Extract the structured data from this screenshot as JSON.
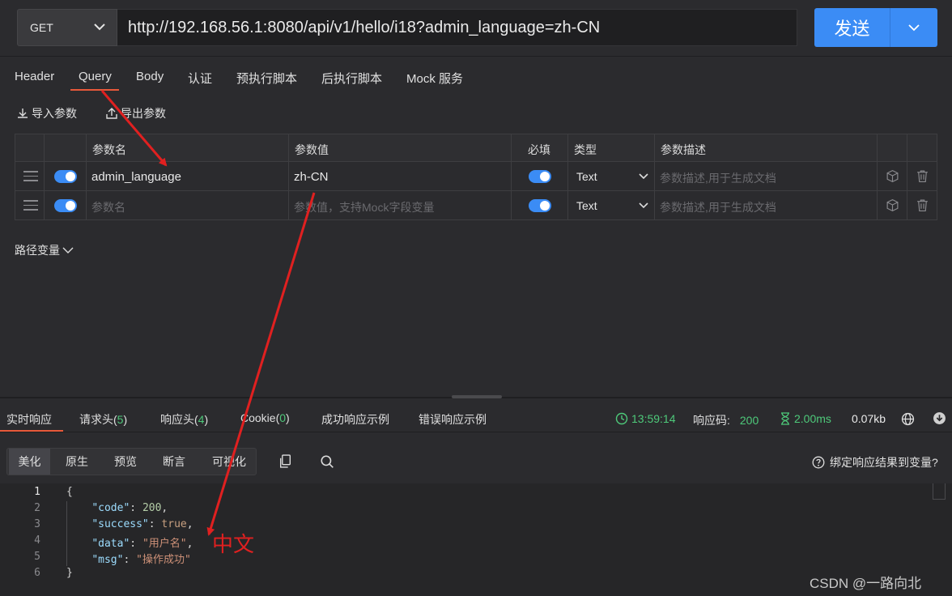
{
  "request": {
    "method": "GET",
    "url": "http://192.168.56.1:8080/api/v1/hello/i18?admin_language=zh-CN",
    "send_label": "发送"
  },
  "request_tabs": [
    "Header",
    "Query",
    "Body",
    "认证",
    "预执行脚本",
    "后执行脚本",
    "Mock 服务"
  ],
  "active_request_tab": "Query",
  "toolbar": {
    "import_label": "导入参数",
    "export_label": "导出参数"
  },
  "params_table": {
    "headers": [
      "参数名",
      "参数值",
      "必填",
      "类型",
      "参数描述"
    ],
    "rows": [
      {
        "name": "admin_language",
        "value": "zh-CN",
        "required": true,
        "type": "Text",
        "desc_placeholder": "参数描述,用于生成文档"
      },
      {
        "name_placeholder": "参数名",
        "value_placeholder": "参数值，支持Mock字段变量",
        "required": true,
        "type": "Text",
        "desc_placeholder": "参数描述,用于生成文档"
      }
    ]
  },
  "path_vars_label": "路径变量",
  "response_tabs": {
    "live": "实时响应",
    "req_headers": "请求头(",
    "req_headers_count": "5",
    "resp_headers": "响应头(",
    "resp_headers_count": "4",
    "cookie": "Cookie(",
    "cookie_count": "0",
    "close": ")",
    "success_example": "成功响应示例",
    "error_example": "错误响应示例"
  },
  "status": {
    "time": "13:59:14",
    "code_label": "响应码:",
    "code": "200",
    "duration": "2.00ms",
    "size": "0.07kb"
  },
  "view_buttons": [
    "美化",
    "原生",
    "预览",
    "断言",
    "可视化"
  ],
  "active_view": "美化",
  "bind_label": "绑定响应结果到变量?",
  "response_body": {
    "line_numbers": [
      "1",
      "2",
      "3",
      "4",
      "5",
      "6"
    ],
    "code": 200,
    "success": "true",
    "data": "用户名",
    "msg": "操作成功"
  },
  "annotation": "中文",
  "watermark": "CSDN @一路向北",
  "colors": {
    "accent": "#3b8cf5",
    "tab_underline": "#e8593a",
    "success": "#4ec97a",
    "annotation": "#e02020"
  }
}
